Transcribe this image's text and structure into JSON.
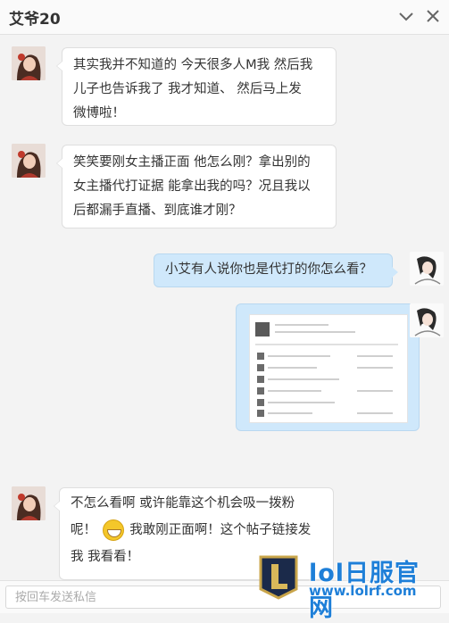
{
  "window": {
    "title": "艾爷20"
  },
  "header": {
    "collapse_icon": "chevron-down-icon",
    "close_icon": "close-icon"
  },
  "messages": [
    {
      "from": "them",
      "text_lines": [
        "其实我并不知道的 今天很多人M我 然后我",
        "儿子也告诉我了 我才知道、 然后马上发",
        "微博啦！"
      ]
    },
    {
      "from": "them",
      "text_lines": [
        "笑笑要刚女主播正面 他怎么刚？拿出别的",
        "女主播代打证据 能拿出我的吗？况且我以",
        "后都漏手直播、到底谁才刚？"
      ]
    },
    {
      "from": "me",
      "text_lines": [
        "小艾有人说你也是代打的你怎么看？"
      ]
    },
    {
      "from": "me",
      "image": "screenshot-of-forum-post"
    },
    {
      "from": "them",
      "text_lines": [
        "不怎么看啊 或许能靠这个机会吸一拨粉",
        "呢！",
        "我敢刚正面啊！这个帖子链接发",
        "我 我看看！"
      ]
    }
  ],
  "input": {
    "placeholder": "按回车发送私信"
  },
  "watermark": {
    "title": "lol日服官网",
    "url": "www.lolrf.com",
    "logo": "L"
  },
  "colors": {
    "my_bubble": "#cfe8fb",
    "their_bubble": "#ffffff",
    "watermark": "#1e7fd8"
  }
}
